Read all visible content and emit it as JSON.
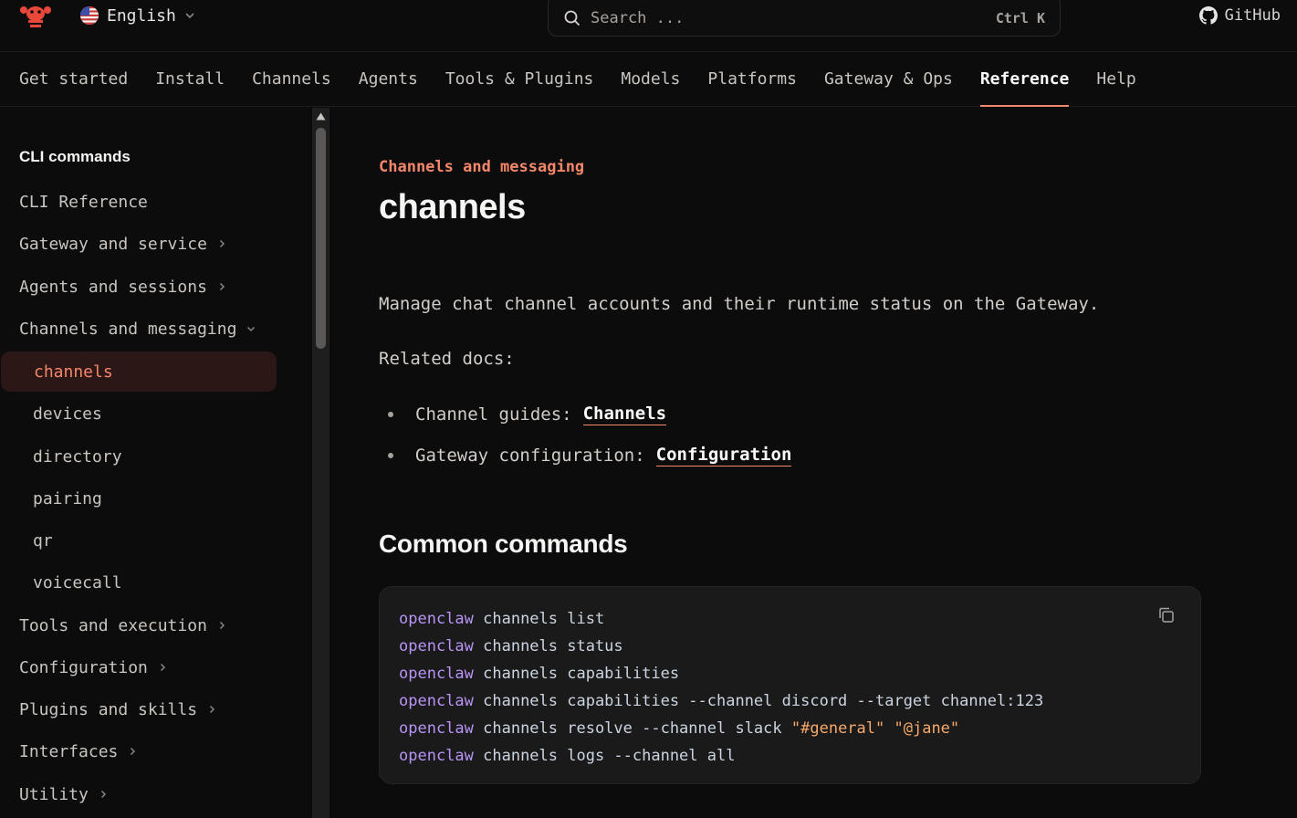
{
  "header": {
    "language": "English",
    "search_placeholder": "Search ...",
    "search_shortcut": "Ctrl K",
    "github_label": "GitHub"
  },
  "tabs": [
    {
      "label": "Get started",
      "active": false
    },
    {
      "label": "Install",
      "active": false
    },
    {
      "label": "Channels",
      "active": false
    },
    {
      "label": "Agents",
      "active": false
    },
    {
      "label": "Tools & Plugins",
      "active": false
    },
    {
      "label": "Models",
      "active": false
    },
    {
      "label": "Platforms",
      "active": false
    },
    {
      "label": "Gateway & Ops",
      "active": false
    },
    {
      "label": "Reference",
      "active": true
    },
    {
      "label": "Help",
      "active": false
    }
  ],
  "sidebar": {
    "heading": "CLI commands",
    "items": [
      {
        "label": "CLI Reference",
        "chevron": "none",
        "child": false,
        "active": false
      },
      {
        "label": "Gateway and service",
        "chevron": "right",
        "child": false,
        "active": false
      },
      {
        "label": "Agents and sessions",
        "chevron": "right",
        "child": false,
        "active": false
      },
      {
        "label": "Channels and messaging",
        "chevron": "down",
        "child": false,
        "active": false
      },
      {
        "label": "channels",
        "chevron": "none",
        "child": true,
        "active": true
      },
      {
        "label": "devices",
        "chevron": "none",
        "child": true,
        "active": false
      },
      {
        "label": "directory",
        "chevron": "none",
        "child": true,
        "active": false
      },
      {
        "label": "pairing",
        "chevron": "none",
        "child": true,
        "active": false
      },
      {
        "label": "qr",
        "chevron": "none",
        "child": true,
        "active": false
      },
      {
        "label": "voicecall",
        "chevron": "none",
        "child": true,
        "active": false
      },
      {
        "label": "Tools and execution",
        "chevron": "right",
        "child": false,
        "active": false
      },
      {
        "label": "Configuration",
        "chevron": "right",
        "child": false,
        "active": false
      },
      {
        "label": "Plugins and skills",
        "chevron": "right",
        "child": false,
        "active": false
      },
      {
        "label": "Interfaces",
        "chevron": "right",
        "child": false,
        "active": false
      },
      {
        "label": "Utility",
        "chevron": "right",
        "child": false,
        "active": false
      }
    ]
  },
  "content": {
    "eyebrow": "Channels and messaging",
    "title": "channels",
    "intro": "Manage chat channel accounts and their runtime status on the Gateway.",
    "related_label": "Related docs:",
    "related": [
      {
        "prefix": "Channel guides:",
        "link": "Channels"
      },
      {
        "prefix": "Gateway configuration:",
        "link": "Configuration"
      }
    ],
    "section_title": "Common commands",
    "code_lines": [
      {
        "cmd": "openclaw",
        "args": " channels list",
        "strings": []
      },
      {
        "cmd": "openclaw",
        "args": " channels status",
        "strings": []
      },
      {
        "cmd": "openclaw",
        "args": " channels capabilities",
        "strings": []
      },
      {
        "cmd": "openclaw",
        "args": " channels capabilities --channel discord --target channel:123",
        "strings": []
      },
      {
        "cmd": "openclaw",
        "args": " channels resolve --channel slack ",
        "strings": [
          "\"#general\"",
          " ",
          "\"@jane\""
        ]
      },
      {
        "cmd": "openclaw",
        "args": " channels logs --channel all",
        "strings": []
      }
    ]
  },
  "colors": {
    "accent": "#f4866a",
    "keyword": "#b794f6",
    "string": "#f6a96b",
    "background": "#0d0c0c"
  }
}
